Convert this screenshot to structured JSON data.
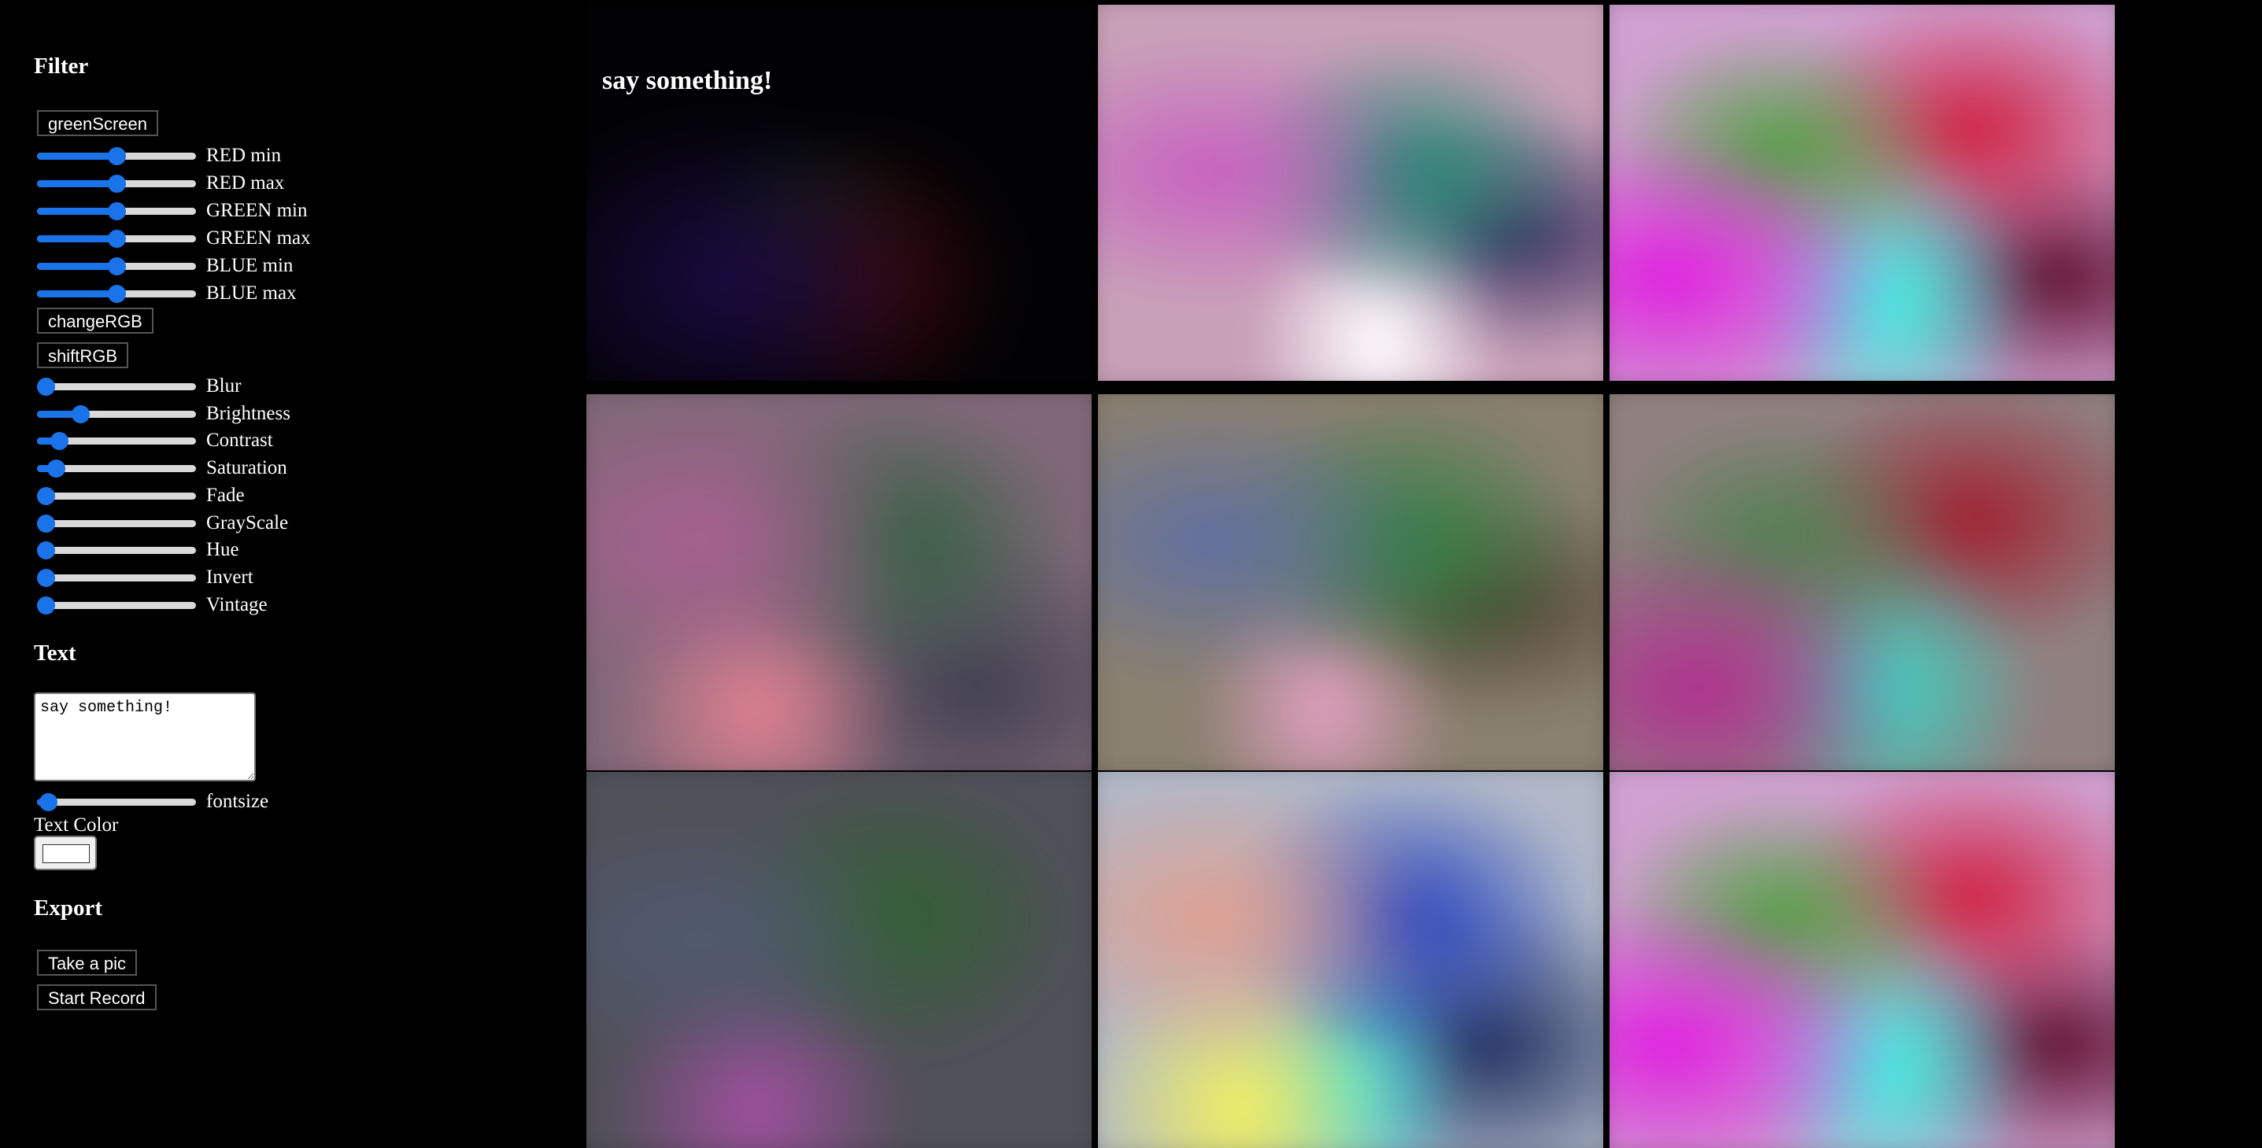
{
  "filter": {
    "heading": "Filter",
    "green_screen_button": "greenScreen",
    "rgb_sliders": [
      {
        "label": "RED min",
        "value": 0.5
      },
      {
        "label": "RED max",
        "value": 0.5
      },
      {
        "label": "GREEN min",
        "value": 0.5
      },
      {
        "label": "GREEN max",
        "value": 0.5
      },
      {
        "label": "BLUE min",
        "value": 0.5
      },
      {
        "label": "BLUE max",
        "value": 0.5
      }
    ],
    "change_rgb_button": "changeRGB",
    "shift_rgb_button": "shiftRGB",
    "effect_sliders": [
      {
        "label": "Blur",
        "value": 0.05
      },
      {
        "label": "Brightness",
        "value": 0.27
      },
      {
        "label": "Contrast",
        "value": 0.14
      },
      {
        "label": "Saturation",
        "value": 0.12
      },
      {
        "label": "Fade",
        "value": 0.0
      },
      {
        "label": "GrayScale",
        "value": 0.0
      },
      {
        "label": "Hue",
        "value": 0.0
      },
      {
        "label": "Invert",
        "value": 0.0
      },
      {
        "label": "Vintage",
        "value": 0.0
      }
    ]
  },
  "text": {
    "heading": "Text",
    "textarea_value": "say something!",
    "fontsize_label": "fontsize",
    "fontsize_value": 0.07,
    "text_color_label": "Text Color",
    "text_color_value": "#ffffff"
  },
  "export": {
    "heading": "Export",
    "take_pic_button": "Take a pic",
    "start_record_button": "Start Record"
  },
  "preview": {
    "overlay_text": "say something!",
    "cell_count": 9
  }
}
